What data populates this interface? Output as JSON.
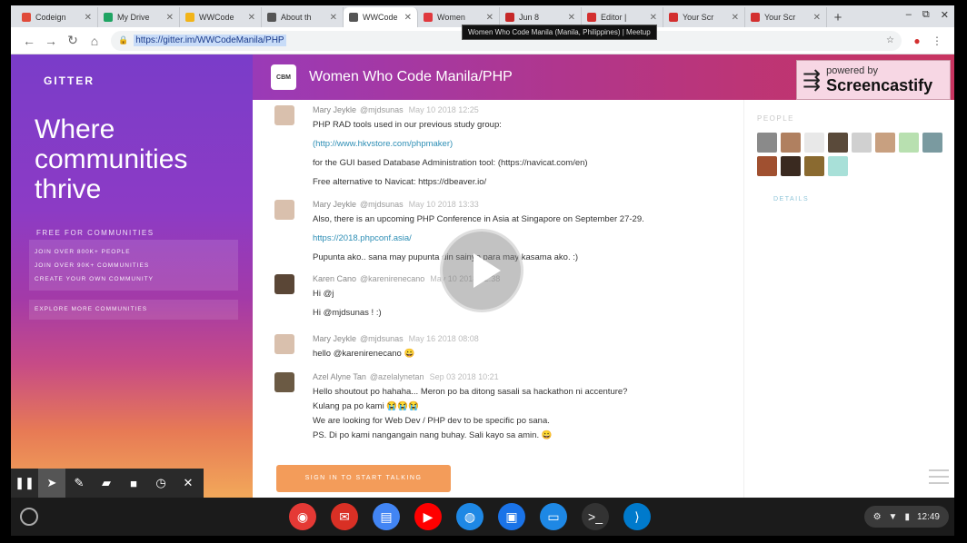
{
  "browser": {
    "tabs": [
      {
        "label": "Codeign",
        "color": "#e04a3a"
      },
      {
        "label": "My Drive",
        "color": "#1fa463"
      },
      {
        "label": "WWCode",
        "color": "#f2b418"
      },
      {
        "label": "About th",
        "color": "#555555"
      },
      {
        "label": "WWCode",
        "color": "#555555",
        "active": true
      },
      {
        "label": "Women",
        "color": "#e0393e"
      },
      {
        "label": "Jun 8",
        "color": "#c62828"
      },
      {
        "label": "Editor |",
        "color": "#d32f2f"
      },
      {
        "label": "Your Scr",
        "color": "#d32f2f"
      },
      {
        "label": "Your Scr",
        "color": "#d32f2f"
      }
    ],
    "url": "https://gitter.im/WWCodeManila/PHP",
    "tooltip": "Women Who Code Manila (Manila, Philippines) | Meetup"
  },
  "left": {
    "brand": "GITTER",
    "tagline": "Where communities thrive",
    "free": "FREE FOR COMMUNITIES",
    "links": [
      "JOIN OVER 800K+ PEOPLE",
      "JOIN OVER 90K+ COMMUNITIES",
      "CREATE YOUR OWN COMMUNITY"
    ],
    "explore": "EXPLORE MORE COMMUNITIES"
  },
  "room": {
    "logo": "CBM",
    "title": "Women Who Code Manila/PHP"
  },
  "castify": {
    "powered": "powered by",
    "name": "Screencastify"
  },
  "messages": [
    {
      "author": "Mary Jeykle",
      "handle": "@mjdsunas",
      "time": "May 10 2018 12:25",
      "lines": [
        {
          "text": "PHP RAD tools used in our previous study group:"
        },
        {
          "text": "(http://www.hkvstore.com/phpmaker)",
          "link": true
        },
        {
          "text": "for the GUI based Database Administration tool: (https://navicat.com/en)"
        },
        {
          "text": "Free alternative to Navicat: https://dbeaver.io/"
        }
      ]
    },
    {
      "author": "Mary Jeykle",
      "handle": "@mjdsunas",
      "time": "May 10 2018 13:33",
      "lines": [
        {
          "text": "Also, there is an upcoming PHP Conference in Asia at Singapore on September 27-29."
        },
        {
          "text": "https://2018.phpconf.asia/",
          "link": true
        },
        {
          "text": "Pupunta ako.. sana may pupunta din sainyo para may kasama ako. :)"
        }
      ]
    },
    {
      "author": "Karen Cano",
      "handle": "@karenirenecano",
      "time": "May 10 2018 22:38",
      "lines": [
        {
          "text": "Hi @j"
        },
        {
          "text": "Hi @mjdsunas ! :)"
        }
      ]
    },
    {
      "author": "Mary Jeykle",
      "handle": "@mjdsunas",
      "time": "May 16 2018 08:08",
      "lines": [
        {
          "text": "hello @karenirenecano 😀"
        }
      ]
    },
    {
      "author": "Azel Alyne Tan",
      "handle": "@azelalynetan",
      "time": "Sep 03 2018 10:21",
      "lines": [
        {
          "text": "Hello shoutout po hahaha... Meron po ba ditong sasali sa hackathon ni accenture?"
        },
        {
          "text": "Kulang pa po kami 😭😭😭"
        },
        {
          "text": "We are looking for Web Dev / PHP dev to be specific po sana."
        },
        {
          "text": "PS. Di po kami nangangain nang buhay. Sali kayo sa amin. 😀"
        }
      ]
    }
  ],
  "signin": "SIGN IN TO START TALKING",
  "people": {
    "label": "PEOPLE",
    "details": "DETAILS",
    "avatars": [
      "#8a8a8a",
      "#b08060",
      "#e8e8e8",
      "#5a4a3a",
      "#d0d0d0",
      "#c8a080",
      "#b8e0b0",
      "#7a9aa0",
      "#a05030",
      "#3a2a20",
      "#8a6a30",
      "#a8e0d8"
    ]
  },
  "shelf": {
    "apps": [
      {
        "name": "chrome",
        "color": "#e53935"
      },
      {
        "name": "gmail",
        "color": "#d93025"
      },
      {
        "name": "docs",
        "color": "#4285f4"
      },
      {
        "name": "youtube",
        "color": "#ff0000"
      },
      {
        "name": "earth",
        "color": "#1e88e5"
      },
      {
        "name": "files",
        "color": "#1a73e8"
      },
      {
        "name": "messages",
        "color": "#1e88e5"
      },
      {
        "name": "terminal",
        "color": "#333333"
      },
      {
        "name": "vscode",
        "color": "#007acc"
      }
    ],
    "time": "12:49"
  }
}
